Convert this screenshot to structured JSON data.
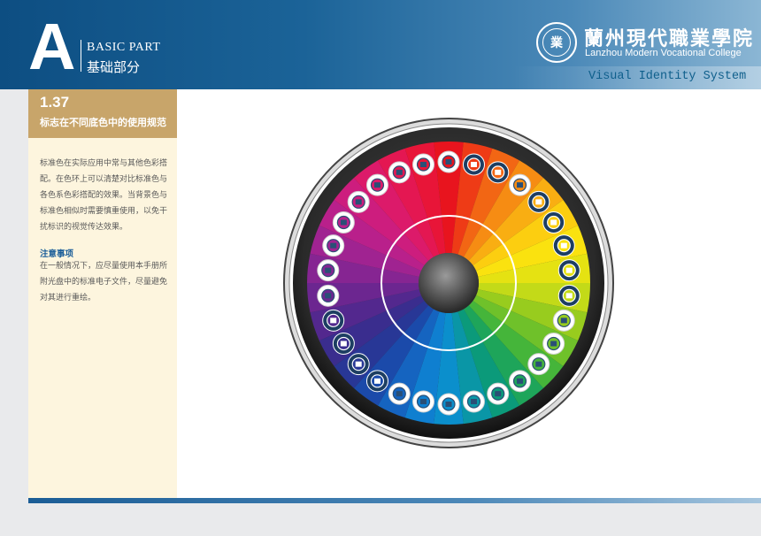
{
  "header": {
    "letter": "A",
    "part_en": "BASIC PART",
    "part_cn": "基础部分",
    "college_cn": "蘭州現代職業學院",
    "college_en": "Lanzhou Modern Vocational College",
    "system_title": "Visual Identity System",
    "logo_glyph": "業"
  },
  "section": {
    "number": "1.37",
    "title": "标志在不同底色中的使用规范",
    "description": "标准色在实际应用中常与其他色彩搭配。在色环上可以清楚对比标准色与各色系色彩搭配的效果。当背景色与标准色相似时需要慎重使用，以免干扰标识的视觉传达效果。",
    "note_title": "注意事项",
    "note_body": "在一般情况下，应尽量使用本手册所附光盘中的标准电子文件，尽量避免对其进行重绘。"
  },
  "wheel": {
    "segment_colors": [
      "#e8141e",
      "#ee3b16",
      "#f26614",
      "#f68c13",
      "#f9ae12",
      "#fcce10",
      "#fae20f",
      "#e5e212",
      "#c3da18",
      "#98cc1e",
      "#6fc12a",
      "#45b53a",
      "#1ea55a",
      "#0b9a7a",
      "#0a96a6",
      "#0b8fcc",
      "#0f7fd0",
      "#1564c0",
      "#1b4aaa",
      "#283796",
      "#3a2d8e",
      "#53288e",
      "#6c2690",
      "#862592",
      "#a02391",
      "#b9208b",
      "#cd1d7e",
      "#dc1a6a",
      "#e41752",
      "#e81538"
    ],
    "logo_tone": [
      "light",
      "dark",
      "dark",
      "light",
      "dark",
      "dark",
      "dark",
      "dark",
      "dark",
      "light",
      "light",
      "light",
      "light",
      "light",
      "light",
      "light",
      "light",
      "light",
      "dark",
      "dark",
      "dark",
      "dark",
      "light",
      "light",
      "light",
      "light",
      "light",
      "light",
      "light",
      "light"
    ]
  }
}
